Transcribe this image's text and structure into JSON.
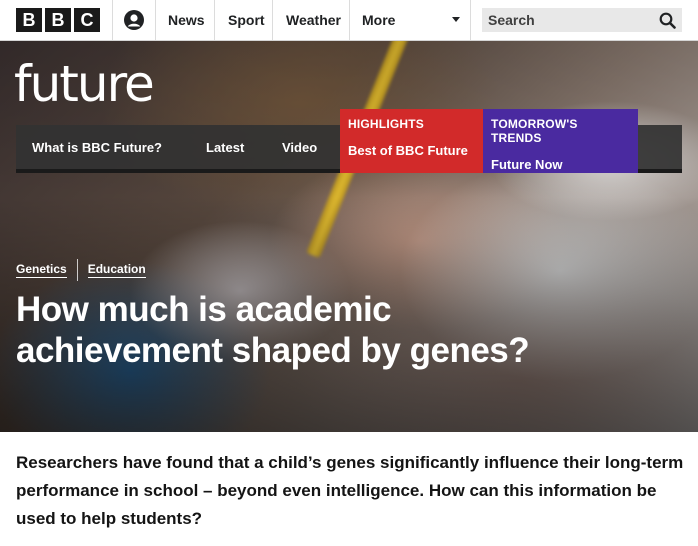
{
  "header": {
    "logo_letters": [
      "B",
      "B",
      "C"
    ],
    "account_icon": "account-icon",
    "nav": [
      {
        "label": "News"
      },
      {
        "label": "Sport"
      },
      {
        "label": "Weather"
      },
      {
        "label": "More"
      }
    ],
    "search": {
      "placeholder": "Search",
      "icon": "search-icon"
    }
  },
  "section": {
    "logo": "future",
    "nav": [
      {
        "label": "What is BBC Future?"
      },
      {
        "label": "Latest"
      },
      {
        "label": "Video"
      }
    ],
    "promos": [
      {
        "kicker": "HIGHLIGHTS",
        "title": "Best of BBC Future",
        "color": "#d22a2a"
      },
      {
        "kicker": "TOMORROW'S TRENDS",
        "title": "Future Now",
        "color": "#4a2aa0"
      }
    ]
  },
  "article": {
    "tags": [
      "Genetics",
      "Education"
    ],
    "headline": "How much is academic achievement shaped by genes?",
    "summary": "Researchers have found that a child’s genes significantly influence their long-term performance in school – beyond even intelligence. How can this information be used to help students?"
  }
}
